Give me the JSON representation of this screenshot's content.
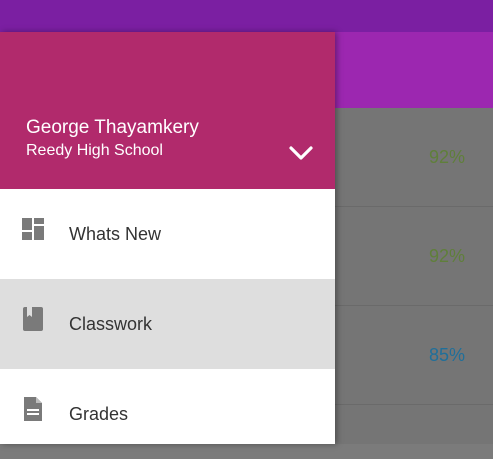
{
  "background": {
    "rows": [
      {
        "value": "92%",
        "color": "#5f7f3a"
      },
      {
        "value": "92%",
        "color": "#5f7f3a"
      },
      {
        "value": "85%",
        "color": "#1f6f9a"
      }
    ]
  },
  "drawer": {
    "user_name": "George Thayamkery",
    "school": "Reedy High School",
    "header_color": "#b12a6c",
    "toggle_icon": "chevron-down-icon",
    "items": [
      {
        "label": "Whats New",
        "icon": "dashboard-icon",
        "active": false
      },
      {
        "label": "Classwork",
        "icon": "book-icon",
        "active": true
      },
      {
        "label": "Grades",
        "icon": "document-icon",
        "active": false
      }
    ]
  }
}
